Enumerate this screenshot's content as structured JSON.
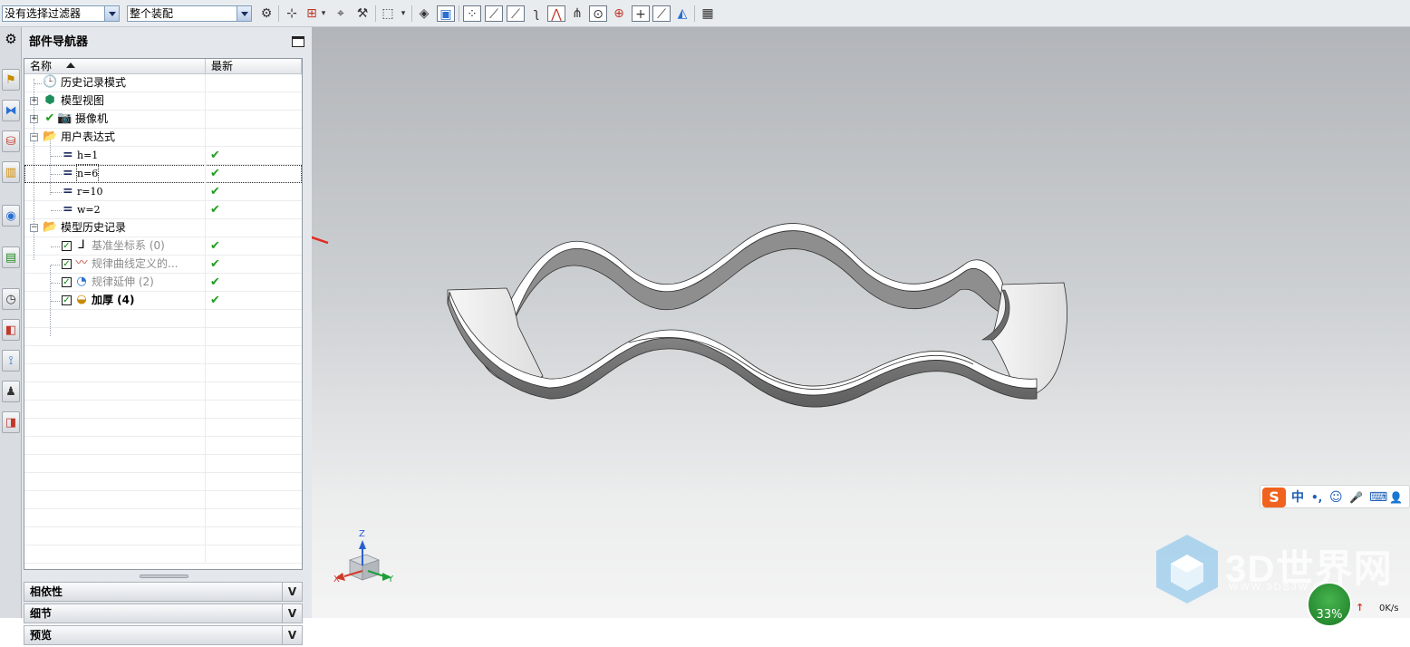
{
  "toolbar": {
    "filter_value": "没有选择过滤器",
    "scope_value": "整个装配"
  },
  "navigator": {
    "title": "部件导航器",
    "columns": {
      "name": "名称",
      "latest": "最新"
    },
    "rows": [
      {
        "label": "历史记录模式",
        "icon": "clock-icon",
        "latest": ""
      },
      {
        "label": "模型视图",
        "icon": "model-views-icon",
        "latest": ""
      },
      {
        "label": "摄像机",
        "icon": "camera-icon",
        "latest": ""
      },
      {
        "label": "用户表达式",
        "icon": "folder-open-icon",
        "latest": ""
      },
      {
        "label": "h=1",
        "icon": "equals-icon",
        "latest": "✔"
      },
      {
        "label": "n=6",
        "icon": "equals-icon",
        "latest": "✔"
      },
      {
        "label": "r=10",
        "icon": "equals-icon",
        "latest": "✔"
      },
      {
        "label": "w=2",
        "icon": "equals-icon",
        "latest": "✔"
      },
      {
        "label": "模型历史记录",
        "icon": "folder-open-icon",
        "latest": ""
      },
      {
        "label": "基准坐标系 (0)",
        "icon": "datum-csys-icon",
        "latest": "✔"
      },
      {
        "label": "规律曲线定义的...",
        "icon": "law-curve-icon",
        "latest": "✔"
      },
      {
        "label": "规律延伸 (2)",
        "icon": "law-extension-icon",
        "latest": "✔"
      },
      {
        "label": "加厚 (4)",
        "icon": "thicken-icon",
        "latest": "✔"
      }
    ],
    "sections": {
      "dependencies": "相依性",
      "details": "细节",
      "preview": "预览"
    }
  },
  "axis_triad": {
    "z": "Z",
    "x": "X",
    "y": "Y"
  },
  "ime_bar": {
    "logo": "S",
    "lang": "中",
    "punct": "•,",
    "emoji": "☺",
    "mic": "🎤",
    "keyboard": "⌨",
    "user": "👤"
  },
  "watermark": {
    "brand": "3D世界网",
    "url": "WWW.3DSJW.COM"
  },
  "net_meter": {
    "percent": "33%",
    "speed": "0K/s",
    "up_arrow": "↑"
  },
  "colors": {
    "annotation_arrow": "#e12a1e",
    "check_green": "#1e9e1e"
  }
}
